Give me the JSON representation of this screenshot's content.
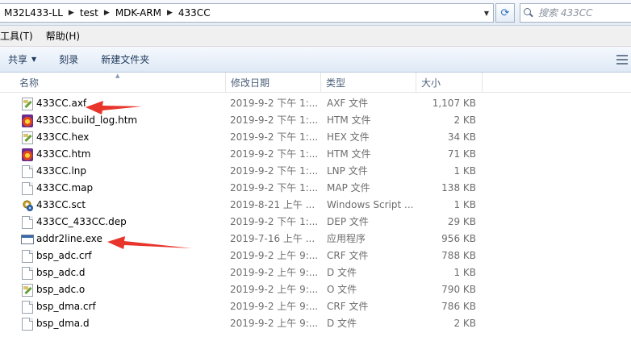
{
  "address": {
    "crumbs": [
      "M32L433-LL",
      "test",
      "MDK-ARM",
      "433CC"
    ]
  },
  "search": {
    "placeholder": "搜索 433CC"
  },
  "menu": {
    "items": [
      "工具(T)",
      "帮助(H)"
    ]
  },
  "toolbar": {
    "share_label": "共享",
    "burn_label": "刻录",
    "new_folder_label": "新建文件夹"
  },
  "columns": {
    "name": "名称",
    "date": "修改日期",
    "type": "类型",
    "size": "大小"
  },
  "files": [
    {
      "name": "433CC.axf",
      "date": "2019-9-2 下午 1:...",
      "type": "AXF 文件",
      "size": "1,107 KB",
      "icon": "edit-file-icon"
    },
    {
      "name": "433CC.build_log.htm",
      "date": "2019-9-2 下午 1:...",
      "type": "HTM 文件",
      "size": "2 KB",
      "icon": "html-file-icon"
    },
    {
      "name": "433CC.hex",
      "date": "2019-9-2 下午 1:...",
      "type": "HEX 文件",
      "size": "34 KB",
      "icon": "edit-file-icon"
    },
    {
      "name": "433CC.htm",
      "date": "2019-9-2 下午 1:...",
      "type": "HTM 文件",
      "size": "71 KB",
      "icon": "html-file-icon"
    },
    {
      "name": "433CC.lnp",
      "date": "2019-9-2 下午 1:...",
      "type": "LNP 文件",
      "size": "1 KB",
      "icon": "document-icon"
    },
    {
      "name": "433CC.map",
      "date": "2019-9-2 下午 1:...",
      "type": "MAP 文件",
      "size": "138 KB",
      "icon": "document-icon"
    },
    {
      "name": "433CC.sct",
      "date": "2019-8-21 上午 ...",
      "type": "Windows Script ...",
      "size": "1 KB",
      "icon": "script-file-icon"
    },
    {
      "name": "433CC_433CC.dep",
      "date": "2019-9-2 下午 1:...",
      "type": "DEP 文件",
      "size": "29 KB",
      "icon": "document-icon"
    },
    {
      "name": "addr2line.exe",
      "date": "2019-7-16 上午 ...",
      "type": "应用程序",
      "size": "956 KB",
      "icon": "application-icon"
    },
    {
      "name": "bsp_adc.crf",
      "date": "2019-9-2 上午 9:...",
      "type": "CRF 文件",
      "size": "788 KB",
      "icon": "document-icon"
    },
    {
      "name": "bsp_adc.d",
      "date": "2019-9-2 上午 9:...",
      "type": "D 文件",
      "size": "1 KB",
      "icon": "document-icon"
    },
    {
      "name": "bsp_adc.o",
      "date": "2019-9-2 上午 9:...",
      "type": "O 文件",
      "size": "790 KB",
      "icon": "edit-file-icon"
    },
    {
      "name": "bsp_dma.crf",
      "date": "2019-9-2 上午 9:...",
      "type": "CRF 文件",
      "size": "786 KB",
      "icon": "document-icon"
    },
    {
      "name": "bsp_dma.d",
      "date": "2019-9-2 上午 9:...",
      "type": "D 文件",
      "size": "2 KB",
      "icon": "document-icon"
    }
  ],
  "annotation_color": "#e8342a"
}
